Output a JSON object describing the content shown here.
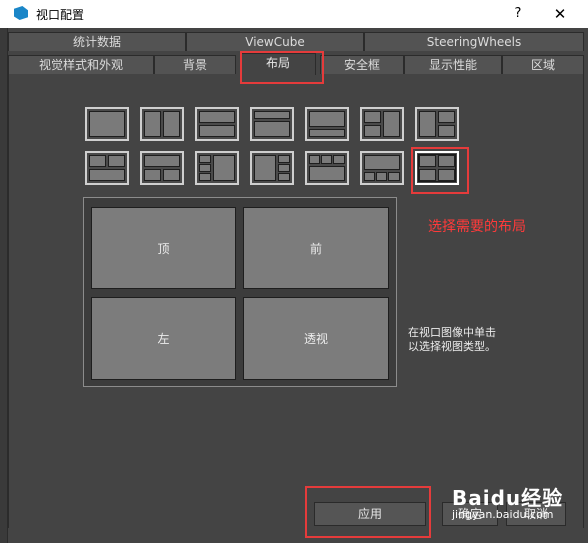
{
  "window": {
    "title": "视口配置",
    "help_label": "?",
    "close_label": "✕"
  },
  "tabs_row1": [
    "统计数据",
    "ViewCube",
    "SteeringWheels"
  ],
  "tabs_row2": [
    "视觉样式和外观",
    "背景",
    "布局",
    "安全框",
    "显示性能",
    "区域"
  ],
  "active_tab": "布局",
  "layout_thumbnails": {
    "count": 14,
    "selected_index": 13
  },
  "preview": {
    "top_left": "顶",
    "top_right": "前",
    "bottom_left": "左",
    "bottom_right": "透视"
  },
  "hint_text": [
    "在视口图像中单击",
    "以选择视图类型。"
  ],
  "annotation": "选择需要的布局",
  "buttons": {
    "apply": "应用",
    "ok": "确定",
    "cancel": "取消"
  },
  "watermark": {
    "logo": "Baidu经验",
    "url": "jingyan.baidu.com"
  },
  "colors": {
    "highlight": "#e53b3b",
    "annotation": "#ff3a3a",
    "panel_bg": "#444444"
  }
}
